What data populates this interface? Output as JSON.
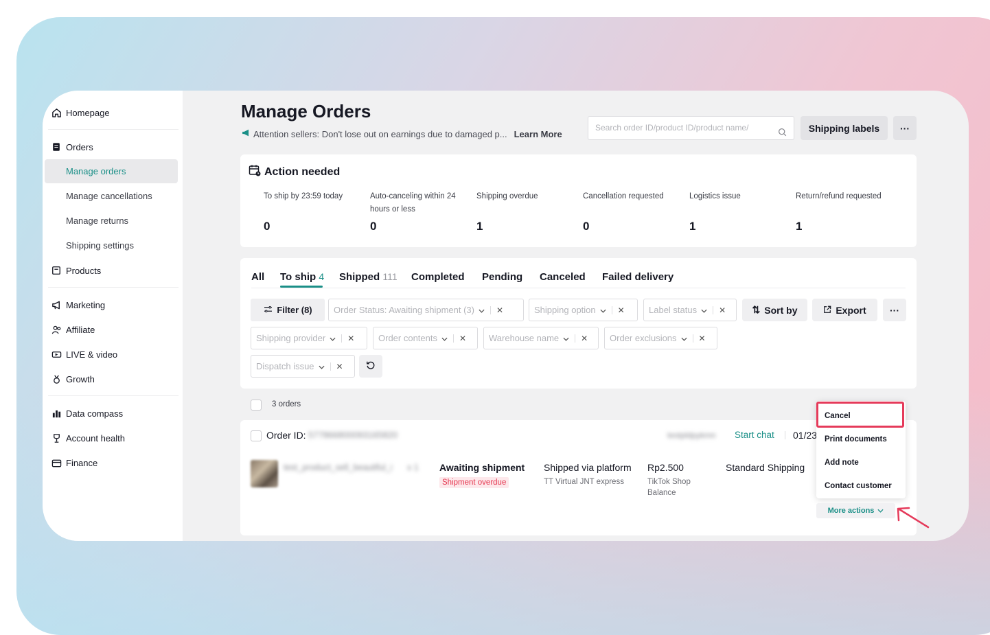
{
  "sidebar": {
    "homepage": "Homepage",
    "orders": "Orders",
    "manage_orders": "Manage orders",
    "manage_cancellations": "Manage cancellations",
    "manage_returns": "Manage returns",
    "shipping_settings": "Shipping settings",
    "products": "Products",
    "marketing": "Marketing",
    "affiliate": "Affiliate",
    "live_video": "LIVE & video",
    "growth": "Growth",
    "data_compass": "Data compass",
    "account_health": "Account health",
    "finance": "Finance"
  },
  "header": {
    "title": "Manage Orders",
    "notice": "Attention sellers: Don't lose out on earnings due to damaged p...",
    "learn_more": "Learn More",
    "search_placeholder": "Search order ID/product ID/product name/",
    "shipping_labels": "Shipping labels",
    "more": "···"
  },
  "action_needed": {
    "title": "Action needed",
    "metrics": [
      {
        "label": "To ship by 23:59 today",
        "value": "0"
      },
      {
        "label": "Auto-canceling within 24 hours or less",
        "value": "0"
      },
      {
        "label": "Shipping overdue",
        "value": "1"
      },
      {
        "label": "Cancellation requested",
        "value": "0"
      },
      {
        "label": "Logistics issue",
        "value": "1"
      },
      {
        "label": "Return/refund requested",
        "value": "1"
      }
    ]
  },
  "tabs": [
    {
      "label": "All",
      "count": ""
    },
    {
      "label": "To ship",
      "count": "4"
    },
    {
      "label": "Shipped",
      "count": "111"
    },
    {
      "label": "Completed",
      "count": ""
    },
    {
      "label": "Pending",
      "count": ""
    },
    {
      "label": "Canceled",
      "count": ""
    },
    {
      "label": "Failed delivery",
      "count": ""
    }
  ],
  "filters": {
    "filter_btn": "Filter (8)",
    "order_status": "Order Status: Awaiting shipment (3)",
    "shipping_option": "Shipping option",
    "label_status": "Label status",
    "sort_by": "Sort by",
    "export": "Export",
    "more": "···",
    "shipping_provider": "Shipping provider",
    "order_contents": "Order contents",
    "warehouse_name": "Warehouse name",
    "order_exclusions": "Order exclusions",
    "dispatch_issue": "Dispatch issue"
  },
  "orders": {
    "count_label": "3 orders",
    "order_id_label": "Order ID:",
    "order_id_value": "577866800093165820",
    "buyer": "testpldpykmn",
    "start_chat": "Start chat",
    "date": "01/23",
    "product_name": "test_product_sell_beautiful_i",
    "quantity": "x 1",
    "status": "Awaiting shipment",
    "status_tag": "Shipment overdue",
    "shipping_method": "Shipped via platform",
    "carrier": "TT Virtual JNT express",
    "price": "Rp2.500",
    "payment_line1": "TikTok Shop",
    "payment_line2": "Balance",
    "shipping_type": "Standard Shipping"
  },
  "dropdown": {
    "cancel": "Cancel",
    "print_documents": "Print documents",
    "add_note": "Add note",
    "contact_customer": "Contact customer",
    "more_actions": "More actions"
  },
  "colors": {
    "accent": "#1a8f87",
    "highlight": "#e53a5a"
  }
}
